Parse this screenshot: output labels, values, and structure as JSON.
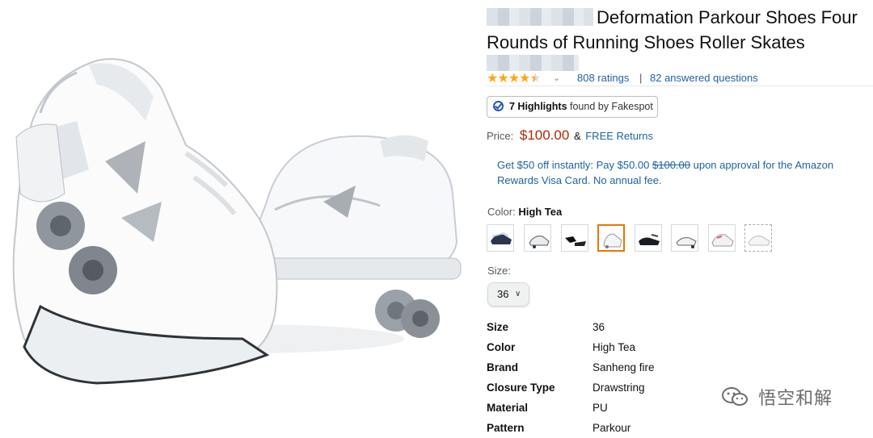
{
  "product": {
    "title": "Deformation Parkour Shoes Four Rounds of Running Shoes Roller Skates"
  },
  "ratings": {
    "stars_value": 4.5,
    "count_label": "808 ratings",
    "separator": "|",
    "answered_label": "82 answered questions"
  },
  "fakespot": {
    "highlights": "7 Highlights",
    "suffix": " found by Fakespot"
  },
  "price": {
    "label": "Price:",
    "value": "$100.00",
    "amp": "&",
    "returns": "FREE Returns"
  },
  "promo": {
    "text_before": "Get $50 off instantly: Pay $50.00 ",
    "struck": "$100.00",
    "text_after": " upon approval for the Amazon Rewards Visa Card. No annual fee."
  },
  "color": {
    "label": "Color:",
    "selected": "High Tea",
    "swatch_count": 8,
    "selected_index": 3
  },
  "size": {
    "label": "Size:",
    "selected": "36"
  },
  "specs": [
    {
      "key": "Size",
      "value": "36"
    },
    {
      "key": "Color",
      "value": "High Tea"
    },
    {
      "key": "Brand",
      "value": "Sanheng fire"
    },
    {
      "key": "Closure Type",
      "value": "Drawstring"
    },
    {
      "key": "Material",
      "value": "PU"
    },
    {
      "key": "Pattern",
      "value": "Parkour"
    }
  ],
  "watermark": {
    "text": "悟空和解",
    "icon": "wechat-icon"
  },
  "colors": {
    "price": "#b12704",
    "link": "#2162a1",
    "star": "#ffa41c",
    "selected_border": "#e77600"
  }
}
